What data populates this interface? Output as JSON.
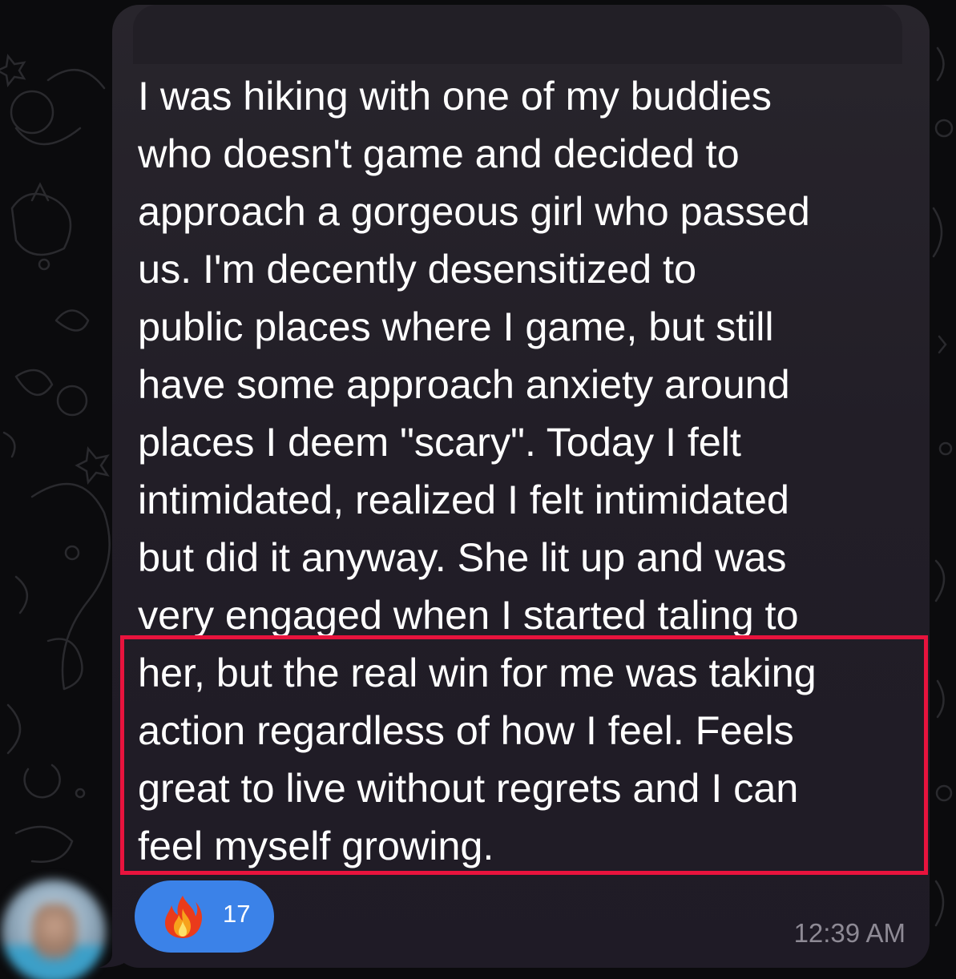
{
  "message": {
    "text": "I was hiking with one of my buddies\nwho doesn't game and decided to\napproach a gorgeous girl who passed\nus. I'm decently desensitized to\npublic places where I game, but still\nhave some approach anxiety around\nplaces I deem \"scary\". Today I felt\nintimidated, realized I felt intimidated\nbut did it anyway. She lit up and was\nvery engaged when I started taling to\nher, but the real win for me was taking\naction regardless of how I feel. Feels\ngreat to live without regrets and I can\nfeel myself growing.",
    "timestamp": "12:39 AM"
  },
  "reaction": {
    "icon": "fire-icon",
    "count": "17"
  },
  "colors": {
    "bubble": "#231f28",
    "highlight": "#e8133d",
    "reaction_pill": "#3b82e8",
    "timestamp": "#8e8a95"
  }
}
